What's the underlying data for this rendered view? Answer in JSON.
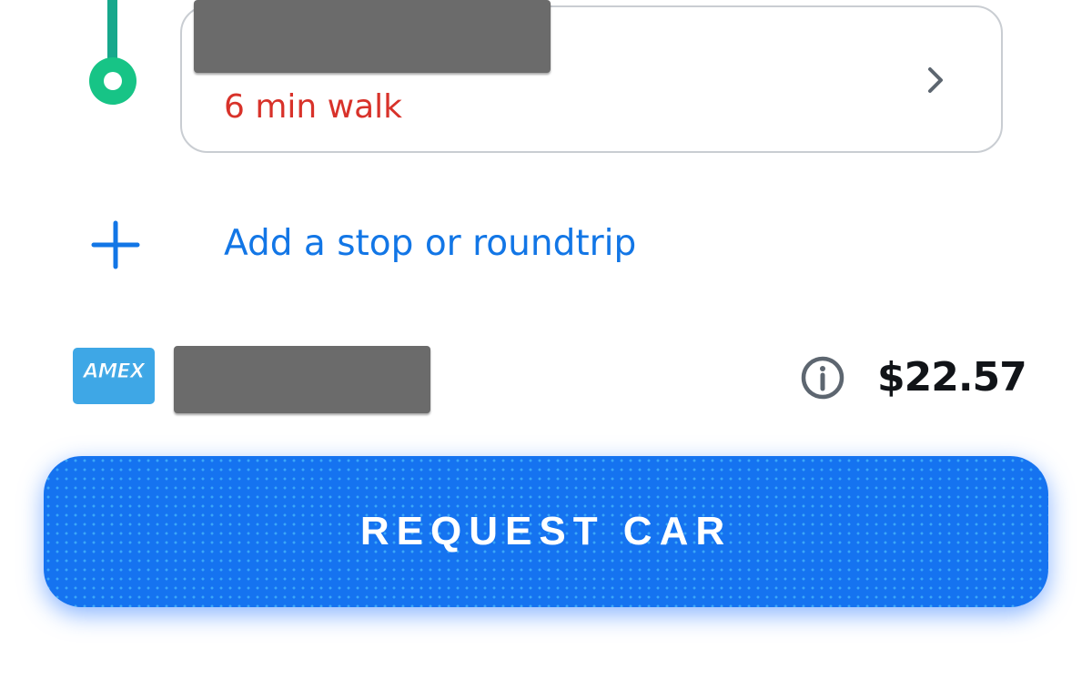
{
  "route": {
    "walk_text": "6 min walk",
    "line_color": "#17a88c",
    "dot_color": "#17c486"
  },
  "add_stop": {
    "label": "Add a stop or roundtrip"
  },
  "payment": {
    "card_brand": "AMEX",
    "price": "$22.57"
  },
  "request_button": {
    "label": "REQUEST CAR"
  },
  "icons": {
    "chevron": "chevron-right-icon",
    "plus": "plus-icon",
    "info": "info-icon"
  },
  "colors": {
    "accent": "#1276e6",
    "button": "#1573f0",
    "walk_warning": "#d8322a",
    "amex": "#3ea7e6"
  }
}
